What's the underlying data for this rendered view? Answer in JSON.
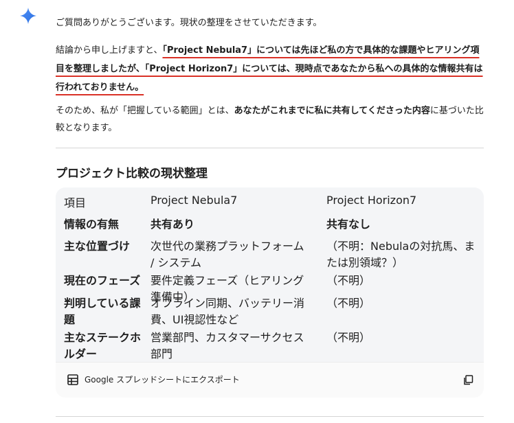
{
  "message": {
    "intro": "ご質問ありがとうございます。現状の整理をさせていただきます。",
    "conclusion_prefix": "結論から申し上げますと、",
    "conclusion_highlight": "「Project Nebula7」については先ほど私の方で具体的な課題やヒアリング項目を整理しましたが、「Project Horizon7」については、現時点であなたから私への具体的な情報共有は行われておりません。",
    "scope_prefix": "そのため、私が「把握している範囲」とは、",
    "scope_bold": "あなたがこれまでに私に共有してくださった内容",
    "scope_suffix": "に基づいた比較となります。"
  },
  "section": {
    "heading": "プロジェクト比較の現状整理"
  },
  "table": {
    "headers": [
      "項目",
      "Project Nebula7",
      "Project Horizon7"
    ],
    "rows": [
      {
        "label": "情報の有無",
        "nebula": "共有あり",
        "horizon": "共有なし",
        "bold_values": true
      },
      {
        "label": "主な位置づけ",
        "nebula": "次世代の業務プラットフォーム / システム",
        "horizon": "（不明：Nebulaの対抗馬、または別領域？）",
        "bold_values": false
      },
      {
        "label": "現在のフェーズ",
        "nebula": "要件定義フェーズ（ヒアリング準備中）",
        "horizon": "（不明）",
        "bold_values": false
      },
      {
        "label": "判明している課題",
        "nebula": "オフライン同期、バッテリー消費、UI視認性など",
        "horizon": "（不明）",
        "bold_values": false
      },
      {
        "label": "主なステークホルダー",
        "nebula": "営業部門、カスタマーサクセス部門",
        "horizon": "（不明）",
        "bold_values": false
      }
    ]
  },
  "export": {
    "label": "Google スプレッドシートにエクスポート",
    "sheet_icon": "table-icon",
    "copy_icon": "copy-icon"
  },
  "colors": {
    "accent_spark": "#3b7ded",
    "highlight_underline": "#d93025"
  }
}
